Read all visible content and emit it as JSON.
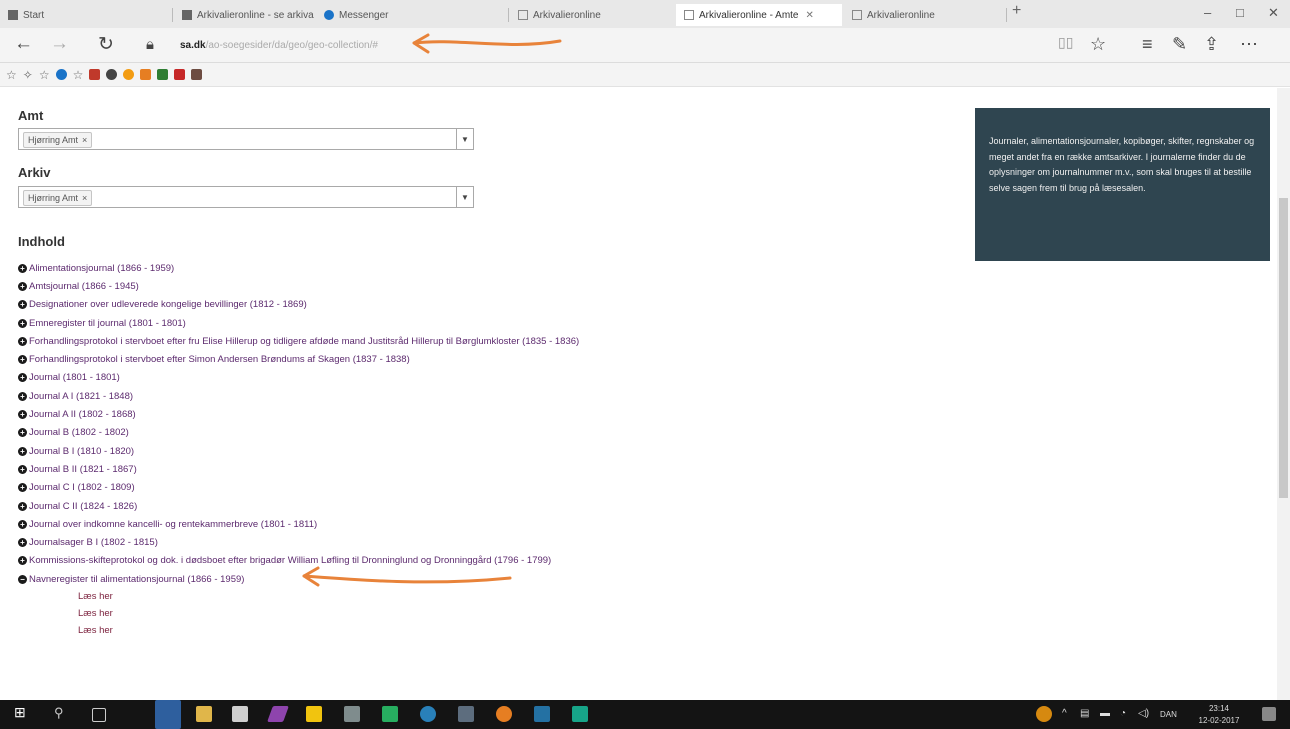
{
  "browser": {
    "tabs": [
      {
        "label": "Start",
        "active": false
      },
      {
        "label": "Arkivalieronline - se arkivali",
        "active": false
      },
      {
        "label": "Messenger",
        "active": false
      },
      {
        "label": "Arkivalieronline",
        "active": false
      },
      {
        "label": "Arkivalieronline - Amte",
        "active": true
      },
      {
        "label": "Arkivalieronline",
        "active": false
      }
    ],
    "new_tab": "+",
    "window_controls": {
      "minimize": "–",
      "maximize": "□",
      "close": "✕"
    },
    "address": {
      "domain": "sa.dk",
      "path": "/ao-soegesider/da/geo/geo-collection/#"
    },
    "nav": {
      "back": "←",
      "forward": "→",
      "refresh": "↻"
    }
  },
  "page": {
    "amt_label": "Amt",
    "amt_chip": "Hjørring Amt",
    "arkiv_label": "Arkiv",
    "arkiv_chip": "Hjørring Amt",
    "chip_remove": "×",
    "indhold_label": "Indhold",
    "items": [
      "Alimentationsjournal (1866 - 1959)",
      "Amtsjournal (1866 - 1945)",
      "Designationer over udleverede kongelige bevillinger (1812 - 1869)",
      "Emneregister til journal (1801 - 1801)",
      "Forhandlingsprotokol i stervboet efter fru Elise Hillerup og tidligere afdøde mand Justitsråd Hillerup til Børglumkloster (1835 - 1836)",
      "Forhandlingsprotokol i stervboet efter Simon Andersen Brøndums af Skagen (1837 - 1838)",
      "Journal (1801 - 1801)",
      "Journal A I (1821 - 1848)",
      "Journal A II (1802 - 1868)",
      "Journal B (1802 - 1802)",
      "Journal B I (1810 - 1820)",
      "Journal B II (1821 - 1867)",
      "Journal C I (1802 - 1809)",
      "Journal C II (1824 - 1826)",
      "Journal over indkomne kancelli- og rentekammerbreve (1801 - 1811)",
      "Journalsager B I (1802 - 1815)",
      "Kommissions-skifteprotokol og dok. i dødsboet efter brigadør William Løfling til Dronninglund og Dronninggård (1796 - 1799)",
      "Navneregister til alimentationsjournal (1866 - 1959)"
    ],
    "expanded_subitems": [
      "Læs her",
      "Læs her",
      "Læs her"
    ],
    "info_text": "Journaler, alimentationsjournaler, kopibøger, skifter, regnskaber og meget andet fra en række amtsarkiver. I journalerne finder du de oplysninger om journalnummer m.v., som skal bruges til at bestille selve sagen frem til brug på læsesalen."
  },
  "taskbar": {
    "language": "DAN",
    "time": "23:14",
    "date": "12-02-2017"
  },
  "colors": {
    "info_bg": "#2f4550",
    "link": "#5c2a6e",
    "annotation": "#e8833a"
  }
}
